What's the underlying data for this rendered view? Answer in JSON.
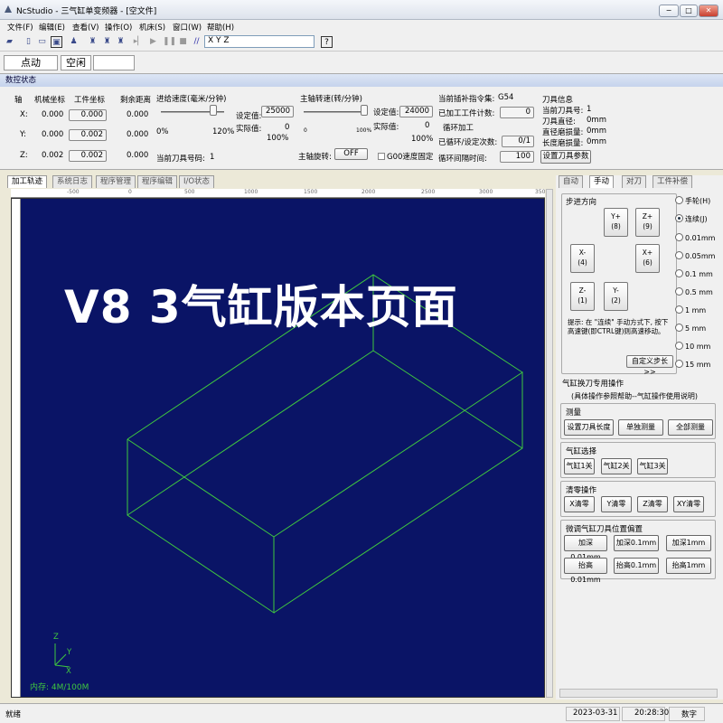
{
  "window": {
    "title": "NcStudio - 三气缸单变频器 - [空文件]",
    "min": "−",
    "max": "□",
    "close": "✕"
  },
  "menu": [
    "文件(F)",
    "编辑(E)",
    "查看(V)",
    "操作(O)",
    "机床(S)",
    "窗口(W)",
    "帮助(H)"
  ],
  "toolbar": {
    "xyz": "X    Y    Z"
  },
  "mode": {
    "left": "点动",
    "right": "空闲"
  },
  "status_title": "数控状态",
  "axis": {
    "headers": [
      "轴",
      "机械坐标",
      "工件坐标",
      "剩余距离"
    ],
    "rows": [
      {
        "axis": "X:",
        "mech": "0.000",
        "work": "0.000",
        "rem": "0.000"
      },
      {
        "axis": "Y:",
        "mech": "0.000",
        "work": "0.002",
        "rem": "0.000"
      },
      {
        "axis": "Z:",
        "mech": "0.002",
        "work": "0.002",
        "rem": "0.000"
      }
    ]
  },
  "feed": {
    "title": "进给速度(毫米/分钟)",
    "set_label": "设定值:",
    "set_value": "25000",
    "act_label": "实际值:",
    "act_value": "0",
    "pct_left": "0%",
    "pct_mid": "120%",
    "pct_right": "100%",
    "tool_label": "当前刀具号码:",
    "tool_value": "1"
  },
  "spindle": {
    "title": "主轴转速(转/分钟)",
    "set_label": "设定值:",
    "set_value": "24000",
    "act_label": "实际值:",
    "act_value": "0",
    "pct_left": "0",
    "pct_mid": "100%",
    "pct_right": "100%",
    "rot_label": "主轴旋转:",
    "rot_value": "OFF",
    "g00": "G00速度固定"
  },
  "coord": {
    "label": "当前插补指令集:",
    "value": "G54",
    "count_label": "已加工工件计数:",
    "count_value": "0",
    "loop": "循环加工",
    "loop_label": "已循环/设定次数:",
    "loop_value": "0/1",
    "interval_label": "循环间隔时间:",
    "interval_value": "100"
  },
  "toolinfo": {
    "title": "刀具信息",
    "num": "当前刀具号:",
    "num_v": "1",
    "dia": "刀具直径:",
    "dia_v": "0mm",
    "r_wear": "直径磨损量:",
    "r_wear_v": "0mm",
    "l_wear": "长度磨损量:",
    "l_wear_v": "0mm",
    "btn": "设置刀具参数"
  },
  "tabs": [
    "加工轨迹",
    "系统日志",
    "程序管理",
    "程序编辑",
    "I/O状态"
  ],
  "ruler": [
    "-500",
    "0",
    "500",
    "1000",
    "1500",
    "2000",
    "2500",
    "3000",
    "350"
  ],
  "overlay": "V8 3气缸版本页面",
  "memory": "内存: 4M/100M",
  "axis_gizmo": {
    "z": "Z",
    "y": "Y",
    "x": "X"
  },
  "rtabs": [
    "自动",
    "手动",
    "对刀",
    "工件补偿"
  ],
  "jog": {
    "title": "步进方向",
    "y_plus": "Y+",
    "y_plus_key": "(8)",
    "z_plus": "Z+",
    "z_plus_key": "(9)",
    "x_minus": "X-",
    "x_minus_key": "(4)",
    "x_plus": "X+",
    "x_plus_key": "(6)",
    "z_minus": "Z-",
    "z_minus_key": "(1)",
    "y_minus": "Y-",
    "y_minus_key": "(2)",
    "tip": "提示: 在 \"连续\" 手动方式下, 按下高速键(即CTRL键)则高速移动。",
    "custom": "自定义步长>>"
  },
  "steps": [
    {
      "label": "手轮(H)",
      "on": false
    },
    {
      "label": "连续(J)",
      "on": true
    },
    {
      "label": "0.01mm",
      "on": false
    },
    {
      "label": "0.05mm",
      "on": false
    },
    {
      "label": "0.1 mm",
      "on": false
    },
    {
      "label": "0.5 mm",
      "on": false
    },
    {
      "label": "1   mm",
      "on": false
    },
    {
      "label": "5   mm",
      "on": false
    },
    {
      "label": "10  mm",
      "on": false
    },
    {
      "label": "15  mm",
      "on": false
    }
  ],
  "cyl": {
    "title": "气缸换刀专用操作",
    "sub": "(具体操作参照帮助--气缸操作使用说明)",
    "measure": "测量",
    "set_len": "设置刀具长度",
    "single": "单独测量",
    "all": "全部测量",
    "select": "气缸选择",
    "c1": "气缸1关",
    "c2": "气缸2关",
    "c3": "气缸3关",
    "zero": "清零操作",
    "xz": "X清零",
    "yz": "Y清零",
    "zz": "Z清零",
    "xyz": "XY清零",
    "adjust": "微调气缸刀具位置偏置",
    "d1": "加深0.01mm",
    "d2": "加深0.1mm",
    "d3": "加深1mm",
    "u1": "抬高0.01mm",
    "u2": "抬高0.1mm",
    "u3": "抬高1mm"
  },
  "statusbar": {
    "ready": "就绪",
    "date": "2023-03-31",
    "time": "20:28:30",
    "mode": "数字"
  }
}
